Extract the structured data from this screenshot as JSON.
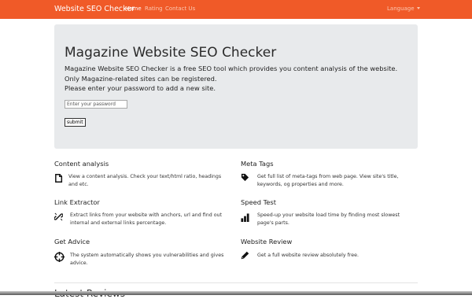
{
  "navbar": {
    "brand": "Website SEO Checker",
    "links": [
      "Home",
      "Rating",
      "Contact Us"
    ],
    "language": "Language",
    "color": "#f05a28"
  },
  "jumbotron": {
    "title": "Magazine Website SEO Checker",
    "lines": [
      "Magazine Website SEO Checker is a free SEO tool which provides you content analysis of the website.",
      "Only Magazine-related sites can be registered.",
      "Please enter your password to add a new site."
    ],
    "password_placeholder": "Enter your password",
    "submit_label": "submit"
  },
  "features": [
    {
      "title": "Content analysis",
      "icon": "document-icon",
      "description": "View a content analysis. Check your text/html ratio, headings and etc."
    },
    {
      "title": "Meta Tags",
      "icon": "tag-icon",
      "description": "Get full list of meta-tags from web page. View site's title, keywords, og properties and more."
    },
    {
      "title": "Link Extractor",
      "icon": "unlink-icon",
      "description": "Extract links from your website with anchors, url and find out internal and external links percentage."
    },
    {
      "title": "Speed Test",
      "icon": "bar-chart-icon",
      "description": "Speed-up your website load time by finding most slowest page's parts."
    },
    {
      "title": "Get Advice",
      "icon": "crosshair-icon",
      "description": "The system automatically shows you vulnerabilities and gives advice."
    },
    {
      "title": "Website Review",
      "icon": "pencil-icon",
      "description": "Get a full website review absolutely free."
    }
  ],
  "reviews_heading": "Latest Reviews"
}
